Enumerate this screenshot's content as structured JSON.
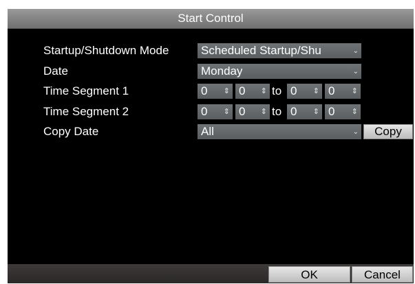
{
  "dialog": {
    "title": "Start Control"
  },
  "form": {
    "mode": {
      "label": "Startup/Shutdown Mode",
      "value": "Scheduled Startup/Shu"
    },
    "date": {
      "label": "Date",
      "value": "Monday"
    },
    "segment1": {
      "label": "Time Segment 1",
      "start_hour": "0",
      "start_min": "0",
      "to": "to",
      "end_hour": "0",
      "end_min": "0"
    },
    "segment2": {
      "label": "Time Segment 2",
      "start_hour": "0",
      "start_min": "0",
      "to": "to",
      "end_hour": "0",
      "end_min": "0"
    },
    "copy_date": {
      "label": "Copy Date",
      "value": "All",
      "copy_button": "Copy"
    }
  },
  "footer": {
    "ok_label": "OK",
    "cancel_label": "Cancel"
  },
  "icons": {
    "dropdown": "chevron-down-icon",
    "spinner": "spinner-arrows-icon"
  },
  "colors": {
    "title_bar": "#8a8a8a",
    "background": "#000000",
    "field": "#63676a",
    "button": "#d4d4d4",
    "footer": "#353231"
  }
}
